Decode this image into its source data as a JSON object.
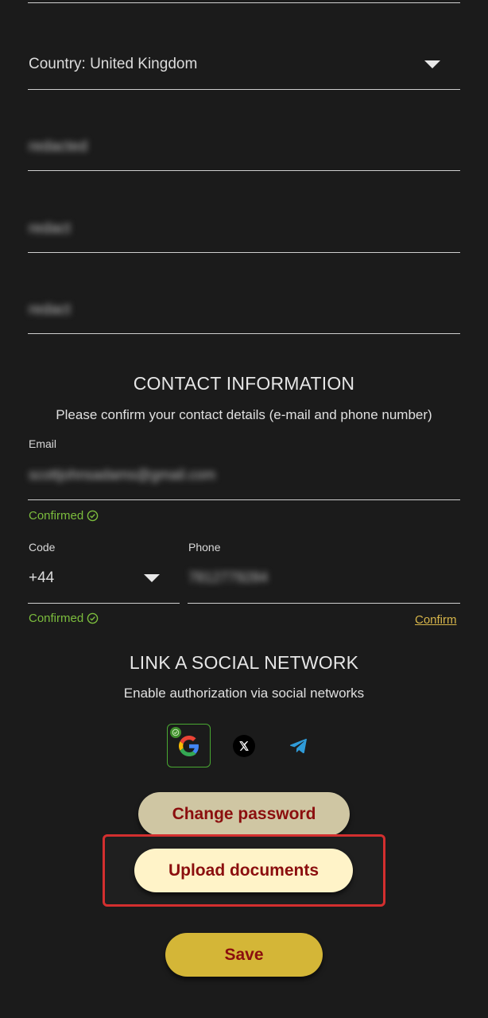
{
  "address": {
    "country_label": "Country: United Kingdom",
    "field_1_value": "redacted",
    "field_2_value": "redact",
    "field_3_value": "redact"
  },
  "contact": {
    "heading": "CONTACT INFORMATION",
    "subtitle": "Please confirm your contact details (e-mail and phone number)",
    "email_label": "Email",
    "email_value": "scottjohnsadams@gmail.com",
    "email_status": "Confirmed",
    "code_label": "Code",
    "code_value": "+44",
    "phone_label": "Phone",
    "phone_value": "7812779284",
    "phone_status": "Confirmed",
    "confirm_link": "Confirm"
  },
  "social": {
    "heading": "LINK A SOCIAL NETWORK",
    "subtitle": "Enable authorization via social networks",
    "icons": [
      "google-icon",
      "x-icon",
      "telegram-icon"
    ],
    "google_linked": true
  },
  "buttons": {
    "change_password": "Change password",
    "upload_documents": "Upload documents",
    "save": "Save"
  },
  "colors": {
    "background": "#1b1b1b",
    "confirmed_green": "#7cbd3d",
    "highlight_red": "#d32f2f",
    "button_text": "#8b0e0e",
    "change_password_bg": "#cfc6a3",
    "upload_bg": "#fff3c8",
    "save_bg": "#d4b637"
  }
}
